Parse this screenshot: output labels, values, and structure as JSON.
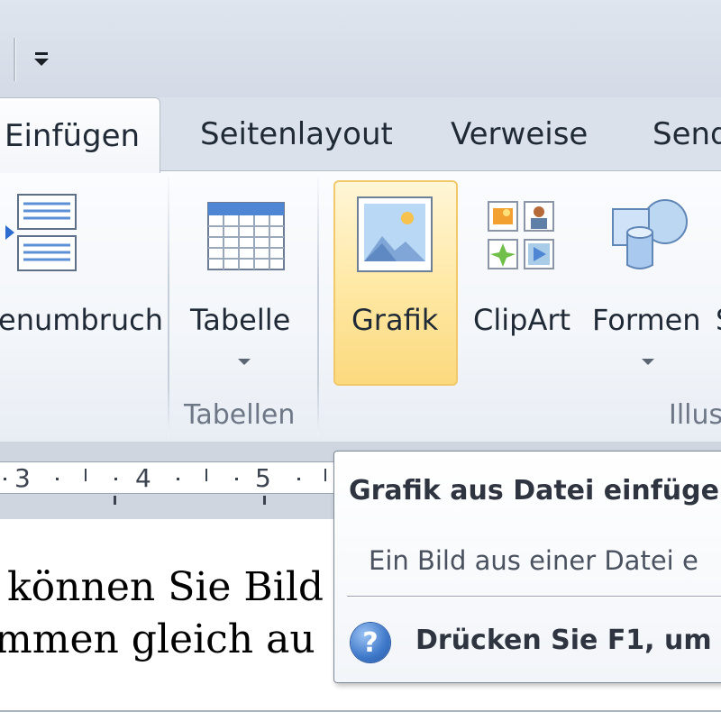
{
  "quick_access": {
    "customize_icon": "customize-dropdown-icon"
  },
  "tabs": [
    {
      "label": "Einfügen",
      "active": true
    },
    {
      "label": "Seitenlayout"
    },
    {
      "label": "Verweise"
    },
    {
      "label": "Send"
    }
  ],
  "ribbon": {
    "seitenumbruch": {
      "label": "enumbruch",
      "icon": "page-break-icon"
    },
    "tabelle": {
      "label": "Tabelle",
      "icon": "table-icon"
    },
    "tabellen_group": "Tabellen",
    "grafik": {
      "label": "Grafik",
      "icon": "picture-icon",
      "highlight_color": "#ffe9a6"
    },
    "clipart": {
      "label": "ClipArt",
      "icon": "clipart-icon"
    },
    "formen": {
      "label": "Formen",
      "icon": "shapes-icon"
    },
    "formen_next": "S",
    "illustrationen_group": "Illus"
  },
  "ruler": {
    "numbers": [
      "3",
      "4",
      "5"
    ]
  },
  "document": {
    "line1": "können Sie Bild",
    "line2": "mmen gleich au"
  },
  "tooltip": {
    "title": "Grafik aus Datei einfüge",
    "description": "Ein Bild aus einer Datei e",
    "help_icon": "help-icon",
    "help_text": "Drücken Sie F1, um"
  }
}
